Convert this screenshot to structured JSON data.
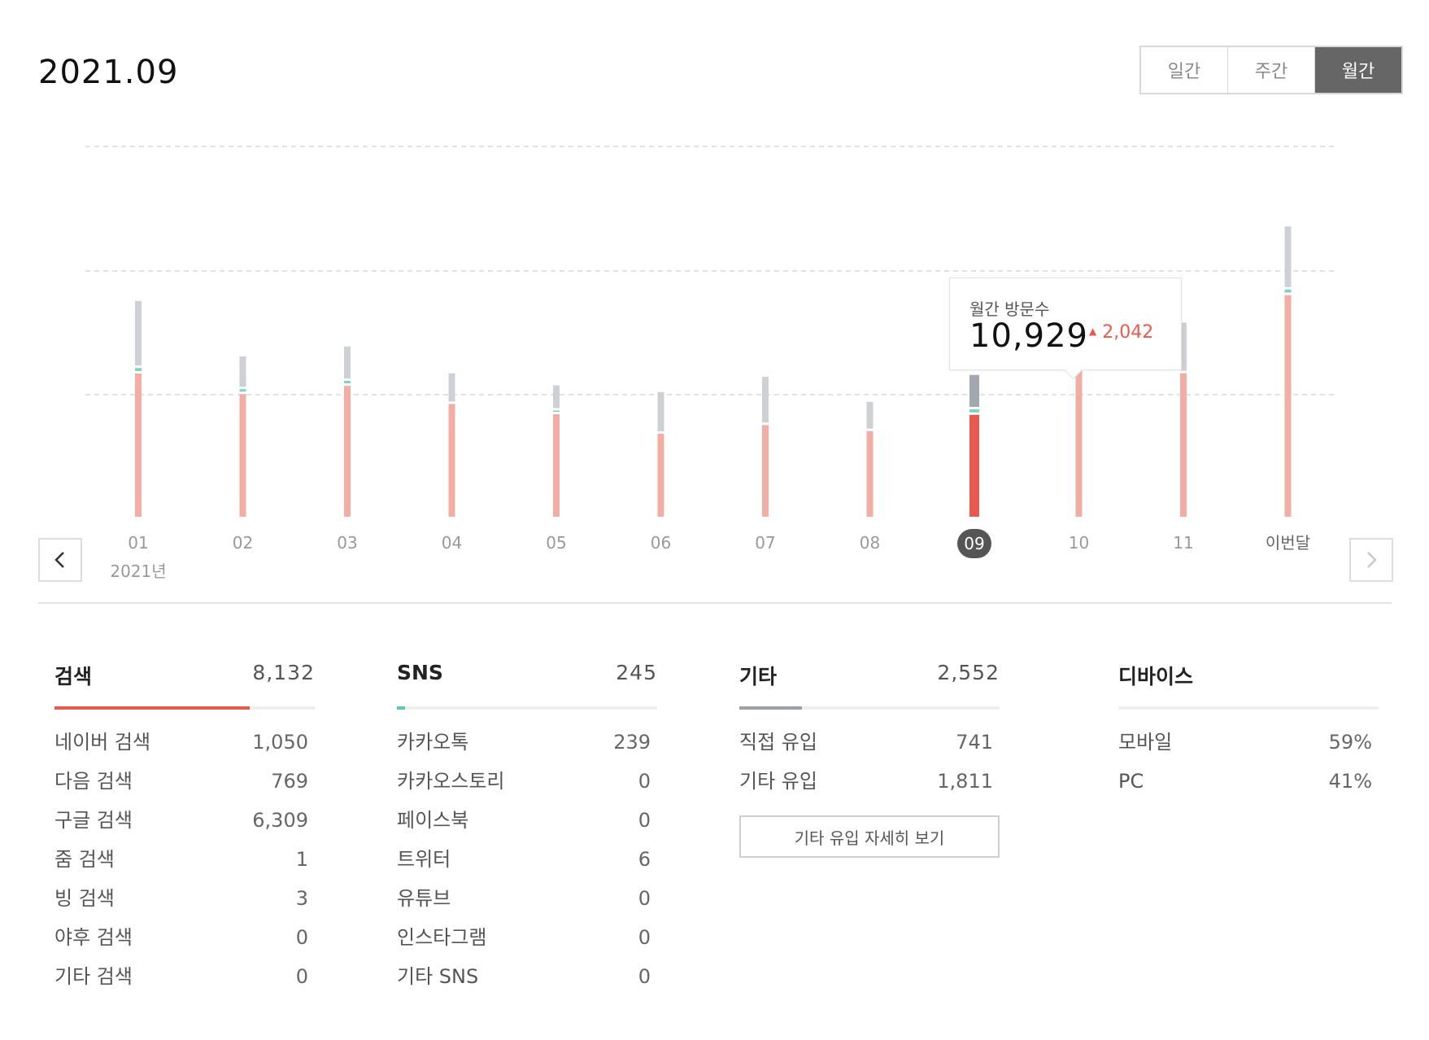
{
  "header": {
    "period_title": "2021.09"
  },
  "tabs": [
    {
      "label": "일간",
      "active": false
    },
    {
      "label": "주간",
      "active": false
    },
    {
      "label": "월간",
      "active": true
    }
  ],
  "chart_data": {
    "type": "bar",
    "stacked": true,
    "categories": [
      "01",
      "02",
      "03",
      "04",
      "05",
      "06",
      "07",
      "08",
      "09",
      "10",
      "11",
      "이번달"
    ],
    "year_label": "2021년",
    "selected_index": 8,
    "grid": true,
    "series": [
      {
        "values": [
          11430,
          9790,
          10450,
          9000,
          8180,
          6620,
          7320,
          6840,
          8132,
          11760,
          11450,
          17690
        ],
        "color": "#f2ada4"
      },
      {
        "values": [
          245,
          200,
          200,
          0,
          100,
          0,
          0,
          0,
          245,
          0,
          0,
          245
        ],
        "color": "#7fd3c2"
      },
      {
        "values": [
          5150,
          2420,
          2540,
          2250,
          1820,
          3130,
          3650,
          2130,
          2552,
          760,
          3850,
          4840
        ],
        "color": "#cdd0d4"
      }
    ],
    "highlight_colors": {
      "base": "#e85a4f",
      "top": "#a3a8ae"
    }
  },
  "tooltip": {
    "title": "월간 방문수",
    "value": "10,929",
    "delta_arrow": "▲",
    "delta": "2,042"
  },
  "stats": {
    "search": {
      "label": "검색",
      "total": "8,132",
      "share": 0.75,
      "color": "#e85a4f",
      "items": [
        {
          "name": "네이버 검색",
          "value": "1,050"
        },
        {
          "name": "다음 검색",
          "value": "769"
        },
        {
          "name": "구글 검색",
          "value": "6,309"
        },
        {
          "name": "줌 검색",
          "value": "1"
        },
        {
          "name": "빙 검색",
          "value": "3"
        },
        {
          "name": "야후 검색",
          "value": "0"
        },
        {
          "name": "기타 검색",
          "value": "0"
        }
      ]
    },
    "sns": {
      "label": "SNS",
      "total": "245",
      "share": 0.03,
      "color": "#5cc9b3",
      "items": [
        {
          "name": "카카오톡",
          "value": "239"
        },
        {
          "name": "카카오스토리",
          "value": "0"
        },
        {
          "name": "페이스북",
          "value": "0"
        },
        {
          "name": "트위터",
          "value": "6"
        },
        {
          "name": "유튜브",
          "value": "0"
        },
        {
          "name": "인스타그램",
          "value": "0"
        },
        {
          "name": "기타 SNS",
          "value": "0"
        }
      ]
    },
    "etc": {
      "label": "기타",
      "total": "2,552",
      "share": 0.24,
      "color": "#9aa0a6",
      "items": [
        {
          "name": "직접 유입",
          "value": "741"
        },
        {
          "name": "기타 유입",
          "value": "1,811"
        }
      ],
      "detail_button": "기타 유입 자세히 보기"
    },
    "device": {
      "label": "디바이스",
      "items": [
        {
          "name": "모바일",
          "value": "59%"
        },
        {
          "name": "PC",
          "value": "41%"
        }
      ]
    }
  }
}
